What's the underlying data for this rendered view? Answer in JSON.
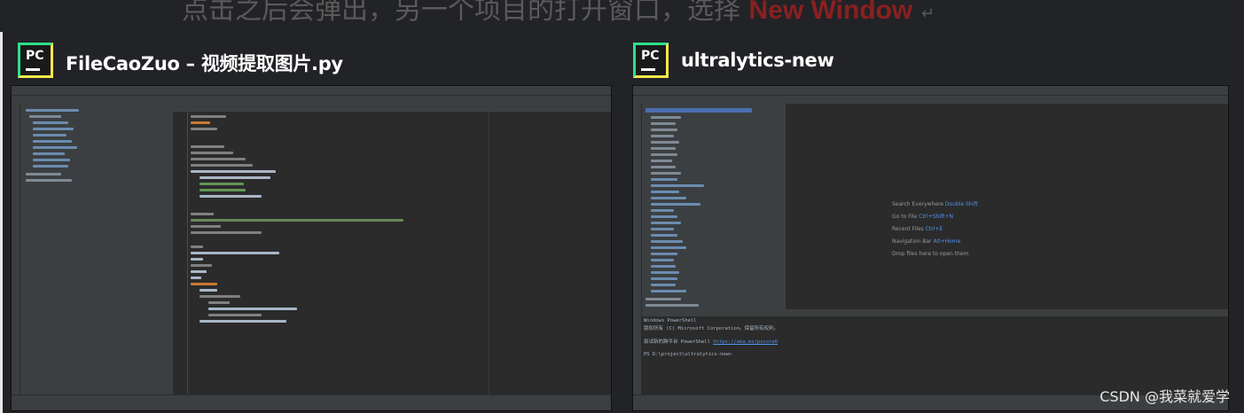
{
  "caption": {
    "text": "点击之后会弹出，另一个项目的打开窗口，选择",
    "highlight": "New Window",
    "return_mark": "↵"
  },
  "windows": [
    {
      "id": "filecaozuo",
      "title": "FileCaoZuo – 视频提取图片.py",
      "icon_label": "PC"
    },
    {
      "id": "ultralytics",
      "title": "ultralytics-new",
      "icon_label": "PC"
    }
  ],
  "welcome": {
    "lines": [
      {
        "label": "Search Everywhere",
        "shortcut": "Double Shift"
      },
      {
        "label": "Go to File",
        "shortcut": "Ctrl+Shift+N"
      },
      {
        "label": "Recent Files",
        "shortcut": "Ctrl+E"
      },
      {
        "label": "Navigation Bar",
        "shortcut": "Alt+Home"
      },
      {
        "label": "Drop files here to open them",
        "shortcut": ""
      }
    ]
  },
  "terminal": {
    "lines": [
      {
        "text": "Windows PowerShell",
        "link": ""
      },
      {
        "text": "版权所有 (C) Microsoft Corporation。保留所有权利。",
        "link": ""
      },
      {
        "text": "尝试新的跨平台 PowerShell",
        "link": "https://aka.ms/pscore6"
      },
      {
        "text": "PS D:\\project\\ultralytics-new>",
        "link": ""
      }
    ]
  },
  "watermark": "CSDN @我菜就爱学",
  "colors": {
    "background": "#222327",
    "ide_panel": "#3c3f41",
    "ide_editor": "#2b2b2b",
    "link": "#5394ec",
    "caption_highlight": "#8a2020",
    "icon_green": "#2ee08a",
    "icon_yellow": "#f6e94a"
  }
}
